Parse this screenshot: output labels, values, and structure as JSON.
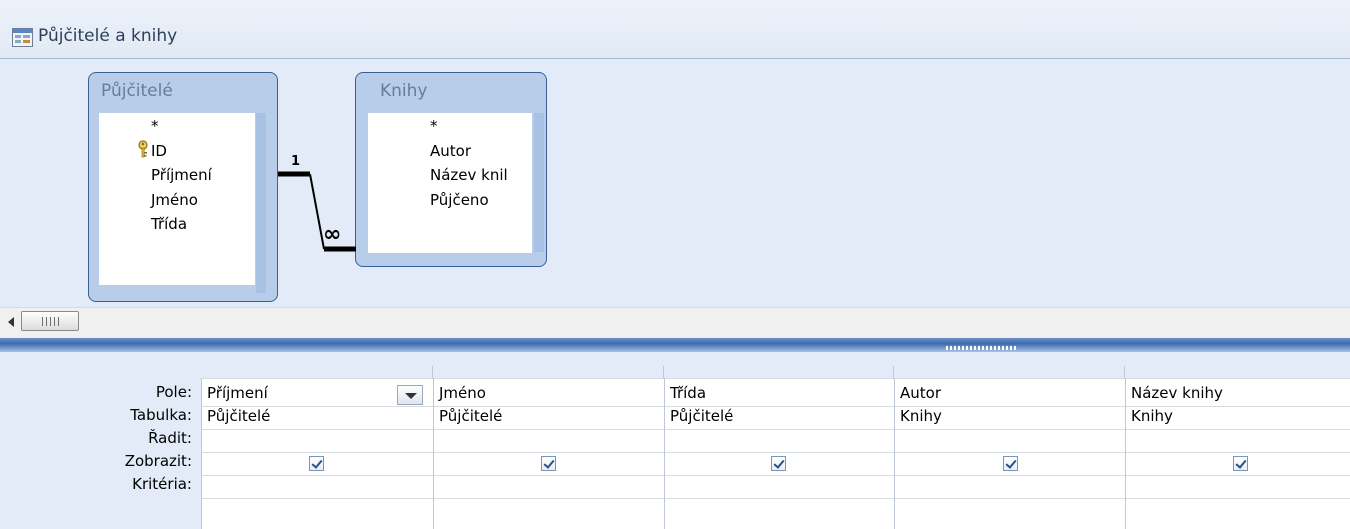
{
  "window": {
    "title": "Půjčitelé a knihy",
    "icon": "query-icon"
  },
  "tables": [
    {
      "name": "Půjčitelé",
      "fields": [
        "*",
        "ID",
        "Příjmení",
        "Jméno",
        "Třída"
      ],
      "primary_key": "ID"
    },
    {
      "name": "Knihy",
      "fields": [
        "*",
        "Autor",
        "Název knil",
        "Půjčeno"
      ]
    }
  ],
  "relationship": {
    "one_side": "1",
    "many_side": "∞"
  },
  "grid": {
    "row_labels": {
      "field": "Pole:",
      "table": "Tabulka:",
      "sort": "Řadit:",
      "show": "Zobrazit:",
      "criteria": "Kritéria:"
    },
    "columns": [
      {
        "field": "Příjmení",
        "table": "Půjčitelé",
        "sort": "",
        "show": true,
        "criteria": ""
      },
      {
        "field": "Jméno",
        "table": "Půjčitelé",
        "sort": "",
        "show": true,
        "criteria": ""
      },
      {
        "field": "Třída",
        "table": "Půjčitelé",
        "sort": "",
        "show": true,
        "criteria": ""
      },
      {
        "field": "Autor",
        "table": "Knihy",
        "sort": "",
        "show": true,
        "criteria": ""
      },
      {
        "field": "Název knihy",
        "table": "Knihy",
        "sort": "",
        "show": true,
        "criteria": ""
      }
    ]
  },
  "colors": {
    "accent": "#3e6cb2",
    "table_border": "#3a5f96",
    "design_bg": "#e2ebf7"
  }
}
